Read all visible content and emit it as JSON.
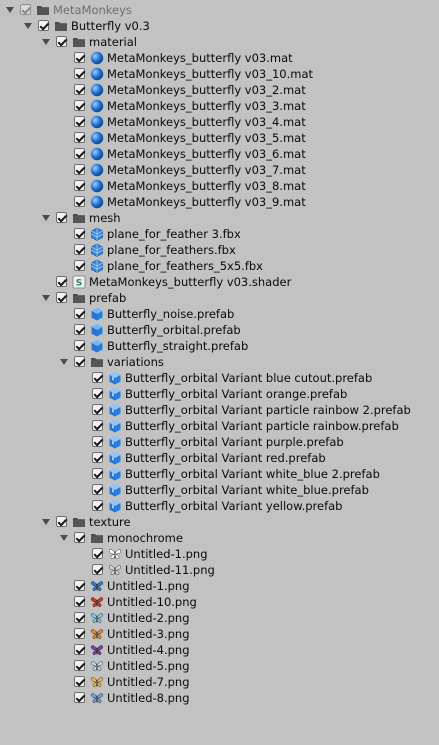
{
  "tree": [
    {
      "depth": 0,
      "expanded": true,
      "icon": "folder-icon",
      "label": "MetaMonkeys",
      "dim": true
    },
    {
      "depth": 1,
      "expanded": true,
      "icon": "folder-icon",
      "label": "Butterfly v0.3"
    },
    {
      "depth": 2,
      "expanded": true,
      "icon": "folder-icon",
      "label": "material"
    },
    {
      "depth": 3,
      "icon": "material-sphere-icon",
      "label": "MetaMonkeys_butterfly v03.mat"
    },
    {
      "depth": 3,
      "icon": "material-sphere-icon",
      "label": "MetaMonkeys_butterfly v03_10.mat"
    },
    {
      "depth": 3,
      "icon": "material-sphere-icon",
      "label": "MetaMonkeys_butterfly v03_2.mat"
    },
    {
      "depth": 3,
      "icon": "material-sphere-icon",
      "label": "MetaMonkeys_butterfly v03_3.mat"
    },
    {
      "depth": 3,
      "icon": "material-sphere-icon",
      "label": "MetaMonkeys_butterfly v03_4.mat"
    },
    {
      "depth": 3,
      "icon": "material-sphere-icon",
      "label": "MetaMonkeys_butterfly v03_5.mat"
    },
    {
      "depth": 3,
      "icon": "material-sphere-icon",
      "label": "MetaMonkeys_butterfly v03_6.mat"
    },
    {
      "depth": 3,
      "icon": "material-sphere-icon",
      "label": "MetaMonkeys_butterfly v03_7.mat"
    },
    {
      "depth": 3,
      "icon": "material-sphere-icon",
      "label": "MetaMonkeys_butterfly v03_8.mat"
    },
    {
      "depth": 3,
      "icon": "material-sphere-icon",
      "label": "MetaMonkeys_butterfly v03_9.mat"
    },
    {
      "depth": 2,
      "expanded": true,
      "icon": "folder-icon",
      "label": "mesh"
    },
    {
      "depth": 3,
      "icon": "mesh-icon",
      "label": "plane_for_feather 3.fbx"
    },
    {
      "depth": 3,
      "icon": "mesh-icon",
      "label": "plane_for_feathers.fbx"
    },
    {
      "depth": 3,
      "icon": "mesh-icon",
      "label": "plane_for_feathers_5x5.fbx"
    },
    {
      "depth": 2,
      "icon": "shader-icon",
      "label": "MetaMonkeys_butterfly v03.shader"
    },
    {
      "depth": 2,
      "expanded": true,
      "icon": "folder-icon",
      "label": "prefab"
    },
    {
      "depth": 3,
      "icon": "prefab-cube-icon",
      "label": "Butterfly_noise.prefab"
    },
    {
      "depth": 3,
      "icon": "prefab-cube-icon",
      "label": "Butterfly_orbital.prefab"
    },
    {
      "depth": 3,
      "icon": "prefab-cube-icon",
      "label": "Butterfly_straight.prefab"
    },
    {
      "depth": 3,
      "expanded": true,
      "icon": "folder-icon",
      "label": "variations"
    },
    {
      "depth": 4,
      "icon": "prefab-variant-icon",
      "label": "Butterfly_orbital Variant blue cutout.prefab"
    },
    {
      "depth": 4,
      "icon": "prefab-variant-icon",
      "label": "Butterfly_orbital Variant orange.prefab"
    },
    {
      "depth": 4,
      "icon": "prefab-variant-icon",
      "label": "Butterfly_orbital Variant particle rainbow 2.prefab"
    },
    {
      "depth": 4,
      "icon": "prefab-variant-icon",
      "label": "Butterfly_orbital Variant particle rainbow.prefab"
    },
    {
      "depth": 4,
      "icon": "prefab-variant-icon",
      "label": "Butterfly_orbital Variant purple.prefab"
    },
    {
      "depth": 4,
      "icon": "prefab-variant-icon",
      "label": "Butterfly_orbital Variant red.prefab"
    },
    {
      "depth": 4,
      "icon": "prefab-variant-icon",
      "label": "Butterfly_orbital Variant white_blue 2.prefab"
    },
    {
      "depth": 4,
      "icon": "prefab-variant-icon",
      "label": "Butterfly_orbital Variant white_blue.prefab"
    },
    {
      "depth": 4,
      "icon": "prefab-variant-icon",
      "label": "Butterfly_orbital Variant yellow.prefab"
    },
    {
      "depth": 2,
      "expanded": true,
      "icon": "folder-icon",
      "label": "texture"
    },
    {
      "depth": 3,
      "expanded": true,
      "icon": "folder-icon",
      "label": "monochrome"
    },
    {
      "depth": 4,
      "icon": "butterfly-texture-icon",
      "color": "#ffffff",
      "label": "Untitled-1.png"
    },
    {
      "depth": 4,
      "icon": "butterfly-texture-icon",
      "color": "#d8d8d8",
      "label": "Untitled-11.png"
    },
    {
      "depth": 3,
      "icon": "butterfly-texture-icon",
      "color": "#2b7fd0",
      "label": "Untitled-1.png"
    },
    {
      "depth": 3,
      "icon": "butterfly-texture-icon",
      "color": "#d8332b",
      "label": "Untitled-10.png"
    },
    {
      "depth": 3,
      "icon": "butterfly-texture-icon",
      "color": "#7ec8e8",
      "label": "Untitled-2.png"
    },
    {
      "depth": 3,
      "icon": "butterfly-texture-icon",
      "color": "#e08a2a",
      "label": "Untitled-3.png"
    },
    {
      "depth": 3,
      "icon": "butterfly-texture-icon",
      "color": "#7b3fa8",
      "label": "Untitled-4.png"
    },
    {
      "depth": 3,
      "icon": "butterfly-texture-icon",
      "color": "#bcd6ee",
      "label": "Untitled-5.png"
    },
    {
      "depth": 3,
      "icon": "butterfly-texture-icon",
      "color": "#e8b84a",
      "label": "Untitled-7.png"
    },
    {
      "depth": 3,
      "icon": "butterfly-texture-icon",
      "color": "#6fa2d8",
      "label": "Untitled-8.png"
    }
  ]
}
